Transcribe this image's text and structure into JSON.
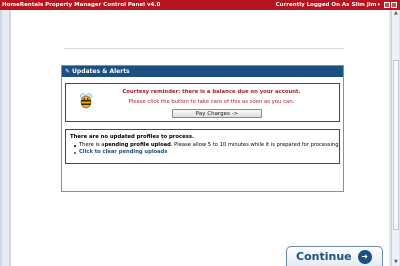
{
  "titlebar": {
    "app_title": "HomeRentals Property Manager Control Panel v4.0",
    "logged_in_label": "Currently Logged On As",
    "user_name": "Slim Jim"
  },
  "panel": {
    "header": "Updates & Alerts",
    "balance_alert": {
      "title": "Courtesy reminder: there is a balance due on your account.",
      "subtitle": "Please click the button to take care of this as soon as you can:",
      "button_label": "Pay Charges ->"
    },
    "profiles_alert": {
      "heading": "There are no updated profiles to process.",
      "pending_prefix": "There is a ",
      "pending_bold": "pending profile upload",
      "pending_suffix": ". Please allow 5 to 10 minutes while it is prepared for processing.",
      "clear_link": "Click to clear pending uploads"
    }
  },
  "continue_button": {
    "label": "Continue"
  },
  "colors": {
    "titlebar": "#b8141f",
    "panel_header": "#1c4f82",
    "alert_red": "#a5202b",
    "link_blue": "#1c4f82"
  }
}
